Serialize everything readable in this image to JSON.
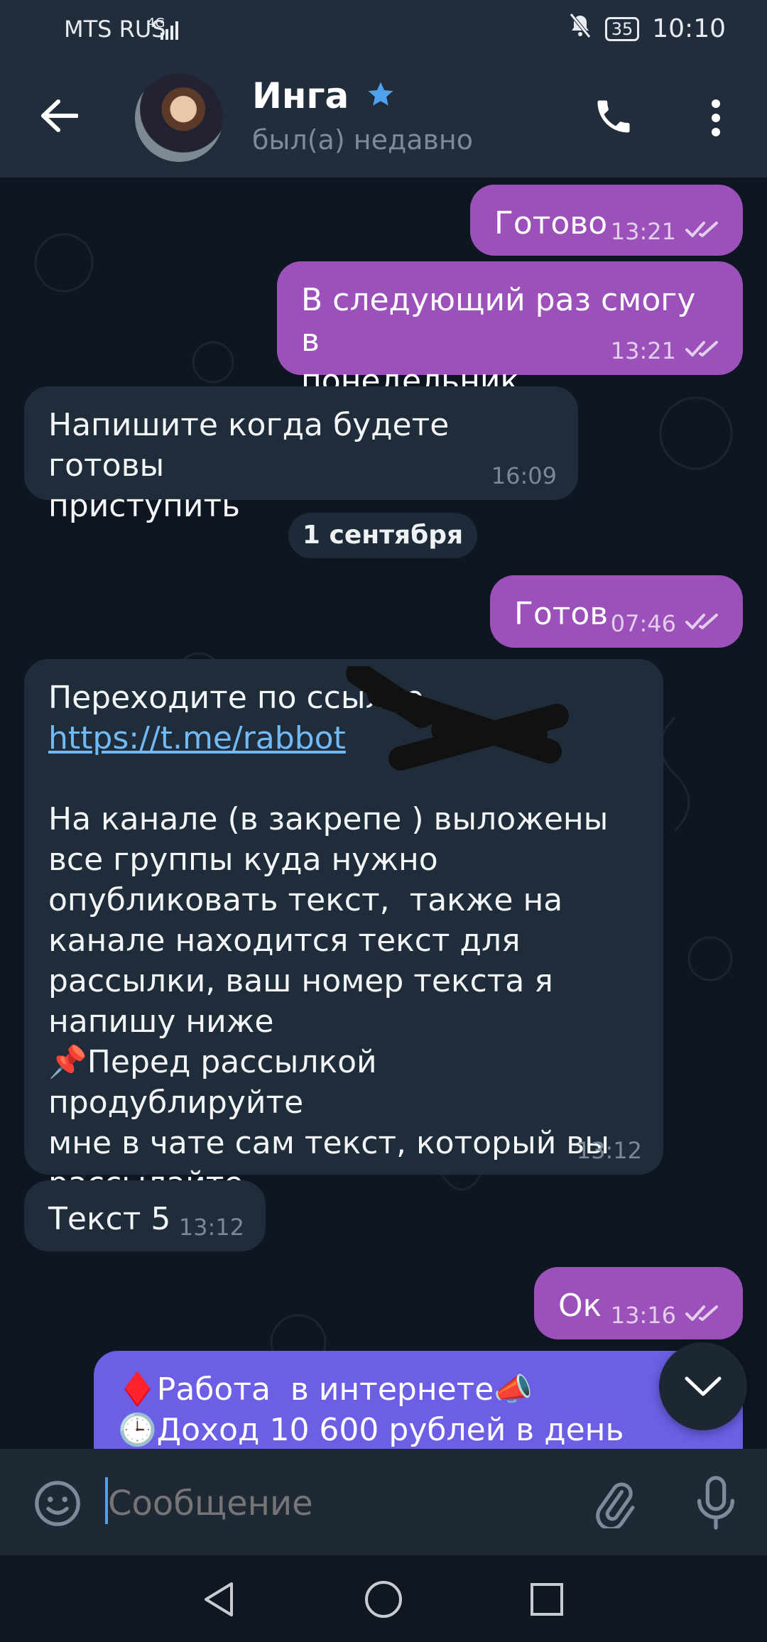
{
  "status_bar": {
    "carrier": "MTS RUS",
    "network": "4G",
    "battery": "35",
    "time": "10:10"
  },
  "header": {
    "back_icon": "arrow-left-icon",
    "name": "Инга",
    "star_icon": "star-icon",
    "status": "был(а) недавно",
    "call_icon": "phone-icon",
    "menu_icon": "more-vert-icon"
  },
  "date_separator": "1 сентября",
  "messages": [
    {
      "dir": "out",
      "text": "Готово",
      "time": "13:21",
      "read": true
    },
    {
      "dir": "out",
      "text": "В следующий раз смогу в\nпонедельник",
      "time": "13:21",
      "read": true
    },
    {
      "dir": "in",
      "text": "Напишите когда будете готовы\nприступить",
      "time": "16:09"
    },
    {
      "dir": "out",
      "text": "Готов",
      "time": "07:46",
      "read": true
    },
    {
      "dir": "in",
      "text_before": "Переходите по ссылке\n",
      "link": "https://t.me/rabbot",
      "text_after": "\n\nНа канале (в закрепе ) выложены\nвсе группы куда нужно\nопубликовать текст,  также на\nканале находится текст для\nрассылки, ваш номер текста я\nнапишу ниже\n📌Перед рассылкой продублируйте\nмне в чате сам текст, который вы\nрассылайте.",
      "time": "13:12"
    },
    {
      "dir": "in",
      "text": "Текст 5",
      "time": "13:12"
    },
    {
      "dir": "out",
      "text": "Ок",
      "time": "13:16",
      "read": true
    },
    {
      "dir": "out",
      "style": "blue",
      "text": "♦️Работа  в интернете📣\n🕒Доход 10 600 рублей в день\n"
    }
  ],
  "input": {
    "placeholder": "Сообщение",
    "emoji_icon": "emoji-icon",
    "attach_icon": "paperclip-icon",
    "mic_icon": "microphone-icon"
  },
  "scroll_down_icon": "chevron-down-icon",
  "navigation": {
    "back_icon": "nav-back-icon",
    "home_icon": "nav-home-icon",
    "recent_icon": "nav-recent-icon"
  },
  "colors": {
    "header": "#212d3b",
    "outgoing": "#9b50ba",
    "outgoing_blue": "#6c5fe6",
    "incoming": "#1f2c3a",
    "link": "#71baf5"
  }
}
